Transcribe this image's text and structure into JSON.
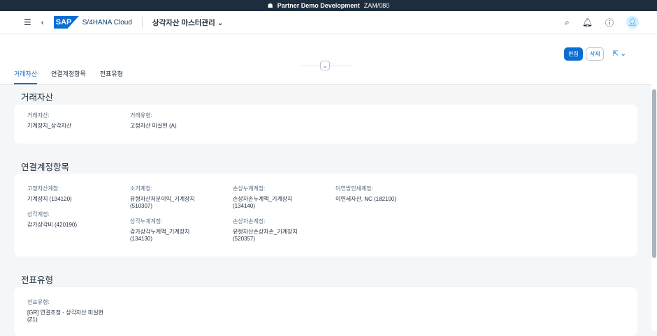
{
  "system_bar": {
    "icon": "people-icon",
    "text": "Partner Demo Development",
    "client": "ZAM/080"
  },
  "shell": {
    "brand": "S/4HANA Cloud",
    "logo": "SAP",
    "app_title": "상각자산 마스터관리"
  },
  "actions": {
    "edit": "편집",
    "delete": "삭제"
  },
  "tabs": [
    "거래자산",
    "연결계정항목",
    "전표유형"
  ],
  "sections": {
    "trade": {
      "title": "거래자산",
      "fields": [
        {
          "label": "거래자산:",
          "value": "기계장치_상각자산"
        },
        {
          "label": "거래유형:",
          "value": "고정자산 미실현 (A)"
        }
      ]
    },
    "accounts": {
      "title": "연결계정항목",
      "fields": [
        {
          "label": "고정자산계정:",
          "value": "기계장치 (134120)"
        },
        {
          "label": "상각계정:",
          "value": "감가상각비 (420190)"
        },
        {
          "label": "소거계정:",
          "value": "유형자산처분이익_기계장치",
          "value2": "(510307)"
        },
        {
          "label": "상각누계계정:",
          "value": "감가상각누계액_기계장치",
          "value2": "(134130)"
        },
        {
          "label": "손상누계계정:",
          "value": "손상차손누계액_기계장치",
          "value2": "(134140)"
        },
        {
          "label": "손상차손계정:",
          "value": "유형자산손상차손_기계장치",
          "value2": "(520357)"
        },
        {
          "label": "이연법인세계정:",
          "value": "이연세자산, NC (182100)"
        }
      ]
    },
    "doc": {
      "title": "전표유형",
      "fields": [
        {
          "label": "전표유형:",
          "value": "[GR] 연결조정 - 상각자산 미실현",
          "value2": "(Z1)"
        }
      ]
    }
  }
}
